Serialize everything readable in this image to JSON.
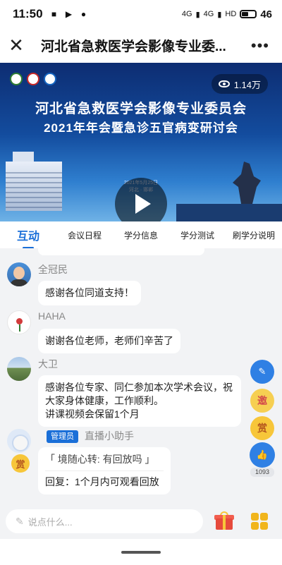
{
  "status_bar": {
    "time": "11:50",
    "network_left": "4G",
    "network_right": "4G",
    "hd": "HD",
    "battery": "46"
  },
  "app_bar": {
    "title": "河北省急救医学会影像专业委..."
  },
  "video": {
    "views": "1.14万",
    "banner_title_line1": "河北省急救医学会影像专业委员会",
    "banner_title_line2": "2021年年会暨急诊五官病变研讨会",
    "banner_date": "2021年5月25日",
    "banner_place": "河北 · 邯郸"
  },
  "tabs": [
    {
      "label": "互动"
    },
    {
      "label": "会议日程"
    },
    {
      "label": "学分信息"
    },
    {
      "label": "学分测试"
    },
    {
      "label": "刷学分说明"
    }
  ],
  "messages": [
    {
      "name": "全冠民",
      "text": "感谢各位同道支持！"
    },
    {
      "name": "HAHA",
      "text": "谢谢各位老师，老师们辛苦了"
    },
    {
      "name": "大卫",
      "text_line1": "感谢各位专家、同仁参加本次学术会议，祝",
      "text_line2": "大家身体健康，工作顺利。",
      "text_line3": "讲课视频会保留1个月"
    },
    {
      "tag": "管理员",
      "name": "直播小助手",
      "reward_badge": "赏",
      "quote": "「 境随心转: 有回放吗 」",
      "reply": "回复：1个月内可观看回放"
    }
  ],
  "side_buttons": {
    "invite_label": "邀",
    "reward_label": "赏",
    "like_count": "1093"
  },
  "input": {
    "placeholder": "说点什么..."
  }
}
